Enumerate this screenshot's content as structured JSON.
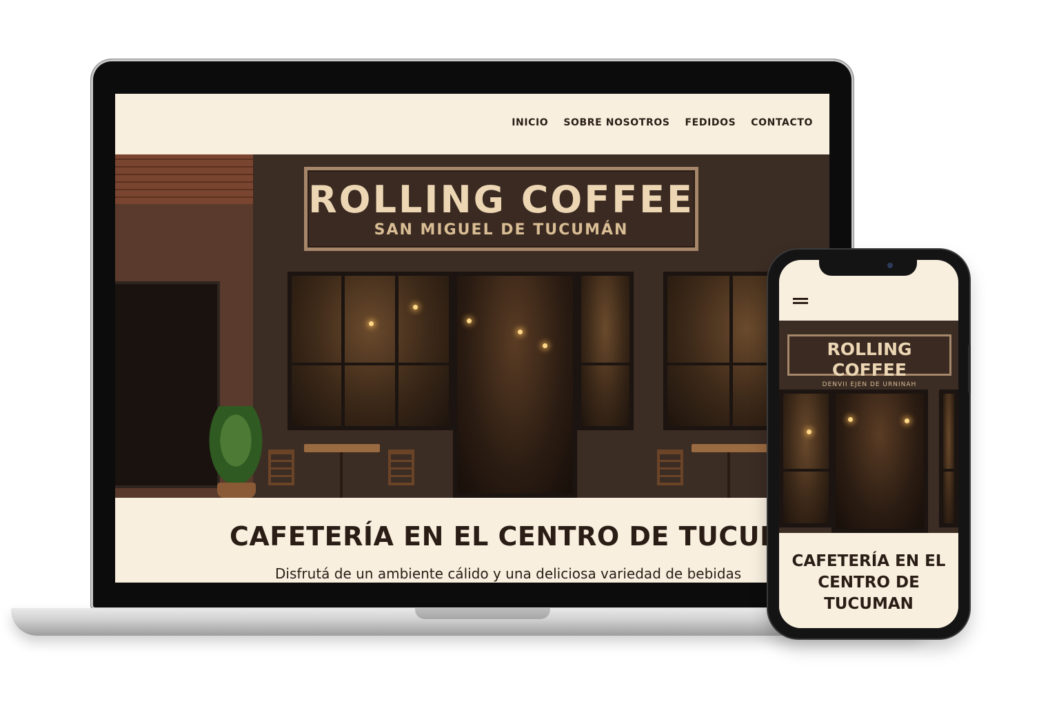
{
  "desktop": {
    "nav": [
      "INICIO",
      "SOBRE NOSOTROS",
      "FEDIDOS",
      "CONTACTO"
    ],
    "sign_title": "ROLLING COFFEE",
    "sign_subtitle": "SAN MIGUEL DE TUCUMÁN",
    "heading": "CAFETERÍA EN EL CENTRO DE TUCUMÁ",
    "text": "Disfrutá de un ambiente cálido y una deliciosa variedad de bebidas"
  },
  "mobile": {
    "menu_icon": "hamburger-icon",
    "sign_title": "ROLLING COFFEE",
    "sign_subtitle": "DENVII EJEN DE URNINAH",
    "heading": "CAFETERÍA EN EL CENTRO DE TUCUMAN"
  },
  "colors": {
    "cream": "#f8efdf",
    "dark_brown": "#2a1d15",
    "facade": "#3b2c24",
    "sign_text": "#ecd6b3"
  }
}
